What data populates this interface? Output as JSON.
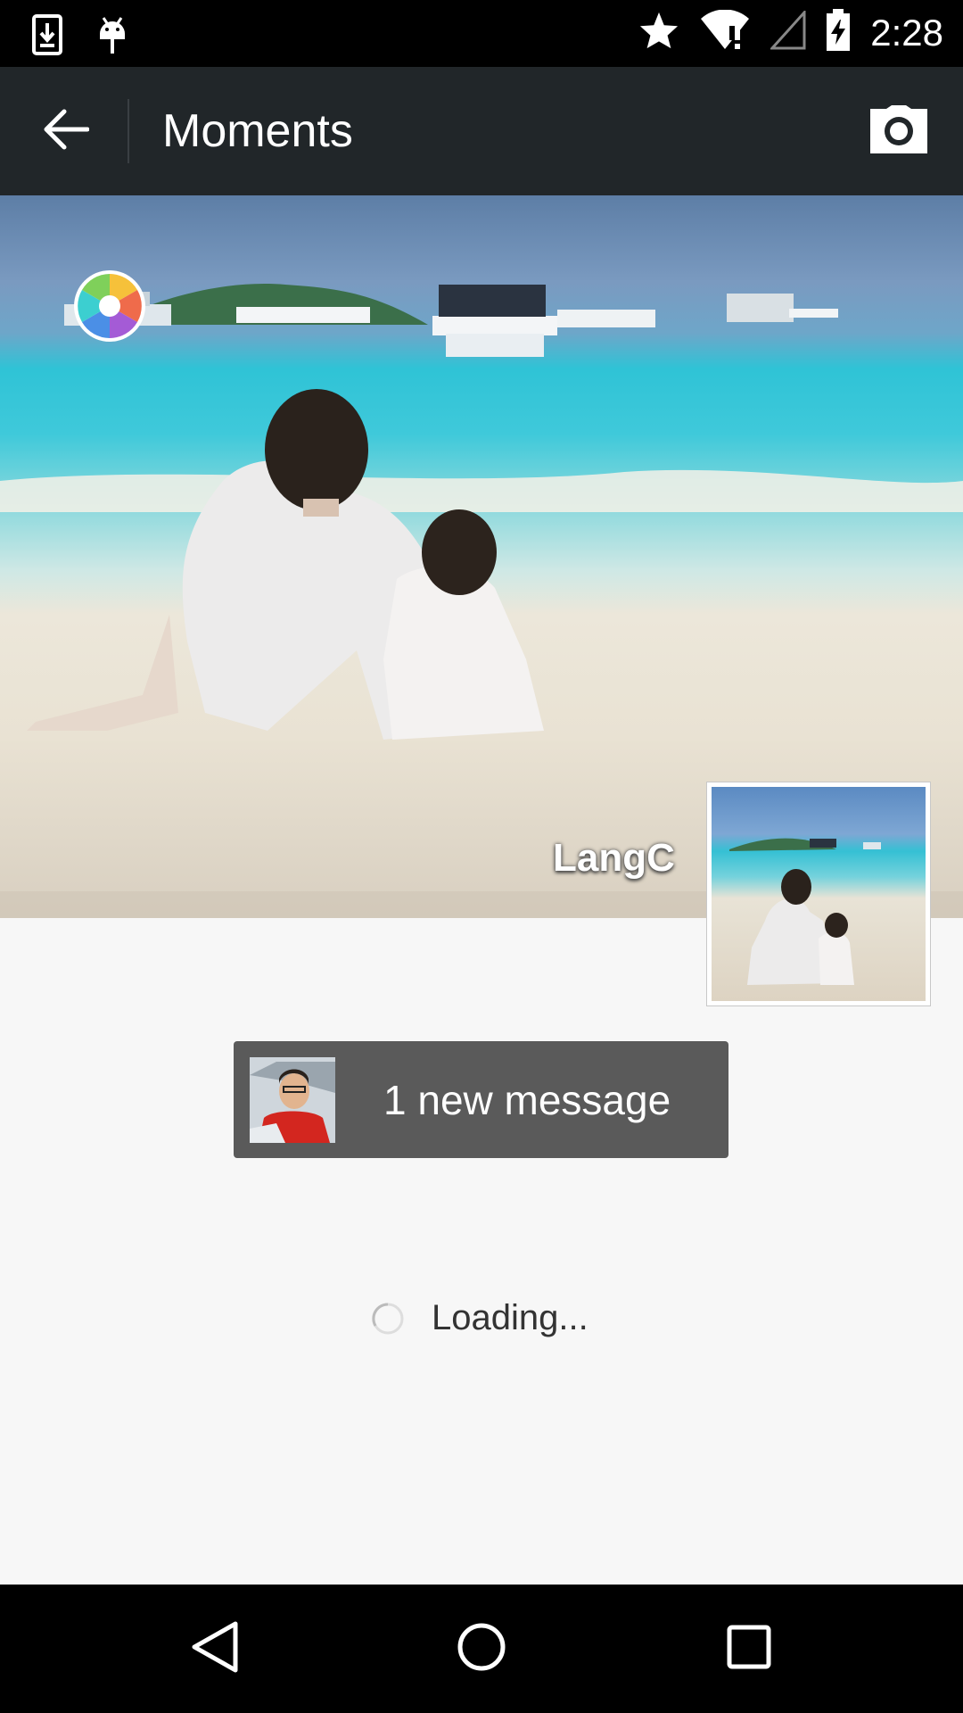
{
  "status_bar": {
    "time": "2:28",
    "icons": [
      "download-icon",
      "android-debug-icon",
      "star-icon",
      "wifi-alert-icon",
      "signal-icon",
      "battery-charging-icon"
    ]
  },
  "app_bar": {
    "title": "Moments",
    "back_icon": "arrow-back-icon",
    "camera_icon": "camera-icon"
  },
  "cover": {
    "username": "LangC",
    "badge_icon": "color-lens-icon"
  },
  "notification": {
    "text": "1 new message"
  },
  "loading": {
    "text": "Loading..."
  },
  "nav_bar": {
    "icons": [
      "back-triangle-icon",
      "home-circle-icon",
      "recents-square-icon"
    ]
  }
}
